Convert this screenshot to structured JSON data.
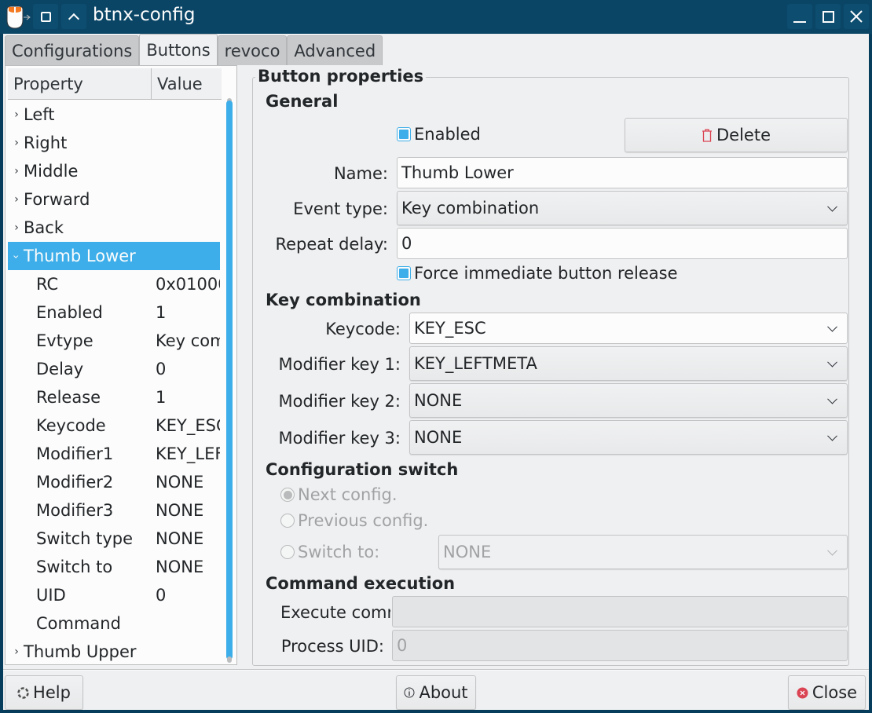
{
  "titlebar": {
    "title": "btnx-config",
    "icons": [
      "app-mouse-icon",
      "keep-below-icon",
      "keep-above-icon",
      "minimize-icon",
      "maximize-icon",
      "close-icon"
    ]
  },
  "tabs": [
    {
      "label": "Configurations",
      "active": false
    },
    {
      "label": "Buttons",
      "active": true
    },
    {
      "label": "revoco",
      "active": false
    },
    {
      "label": "Advanced",
      "active": false
    }
  ],
  "tree": {
    "headers": {
      "property": "Property",
      "value": "Value"
    },
    "top_items_before": [
      "Left",
      "Right",
      "Middle",
      "Forward",
      "Back"
    ],
    "selected": "Thumb Lower",
    "children": [
      {
        "property": "RC",
        "value": "0x01000"
      },
      {
        "property": "Enabled",
        "value": "1"
      },
      {
        "property": "Evtype",
        "value": "Key com"
      },
      {
        "property": "Delay",
        "value": "0"
      },
      {
        "property": "Release",
        "value": "1"
      },
      {
        "property": "Keycode",
        "value": "KEY_ESC"
      },
      {
        "property": "Modifier1",
        "value": "KEY_LEF"
      },
      {
        "property": "Modifier2",
        "value": "NONE"
      },
      {
        "property": "Modifier3",
        "value": "NONE"
      },
      {
        "property": "Switch type",
        "value": "NONE"
      },
      {
        "property": "Switch to",
        "value": "NONE"
      },
      {
        "property": "UID",
        "value": "0"
      },
      {
        "property": "Command",
        "value": ""
      }
    ],
    "top_items_after": [
      "Thumb Upper"
    ]
  },
  "props": {
    "group_title": "Button properties",
    "general": {
      "heading": "General",
      "enabled_label": "Enabled",
      "enabled_checked": true,
      "delete_label": "Delete",
      "name_label": "Name:",
      "name_value": "Thumb Lower",
      "event_type_label": "Event type:",
      "event_type_value": "Key combination",
      "repeat_delay_label": "Repeat delay:",
      "repeat_delay_value": "0",
      "force_release_label": "Force immediate button release",
      "force_release_checked": true
    },
    "keycombo": {
      "heading": "Key combination",
      "keycode_label": "Keycode:",
      "keycode_value": "KEY_ESC",
      "mod1_label": "Modifier key 1:",
      "mod1_value": "KEY_LEFTMETA",
      "mod2_label": "Modifier key 2:",
      "mod2_value": "NONE",
      "mod3_label": "Modifier key 3:",
      "mod3_value": "NONE"
    },
    "configswitch": {
      "heading": "Configuration switch",
      "next_label": "Next config.",
      "prev_label": "Previous config.",
      "switch_to_label": "Switch to:",
      "switch_to_value": "NONE",
      "selected": "Next config."
    },
    "command": {
      "heading": "Command execution",
      "execute_label": "Execute comr",
      "execute_value": "",
      "uid_label": "Process UID:",
      "uid_value": "0"
    }
  },
  "footer": {
    "help_label": "Help",
    "about_label": "About",
    "close_label": "Close"
  },
  "colors": {
    "accent": "#3daee9",
    "titlebar": "#0a4566",
    "delete_icon": "#da4453",
    "close_icon": "#da4453"
  }
}
